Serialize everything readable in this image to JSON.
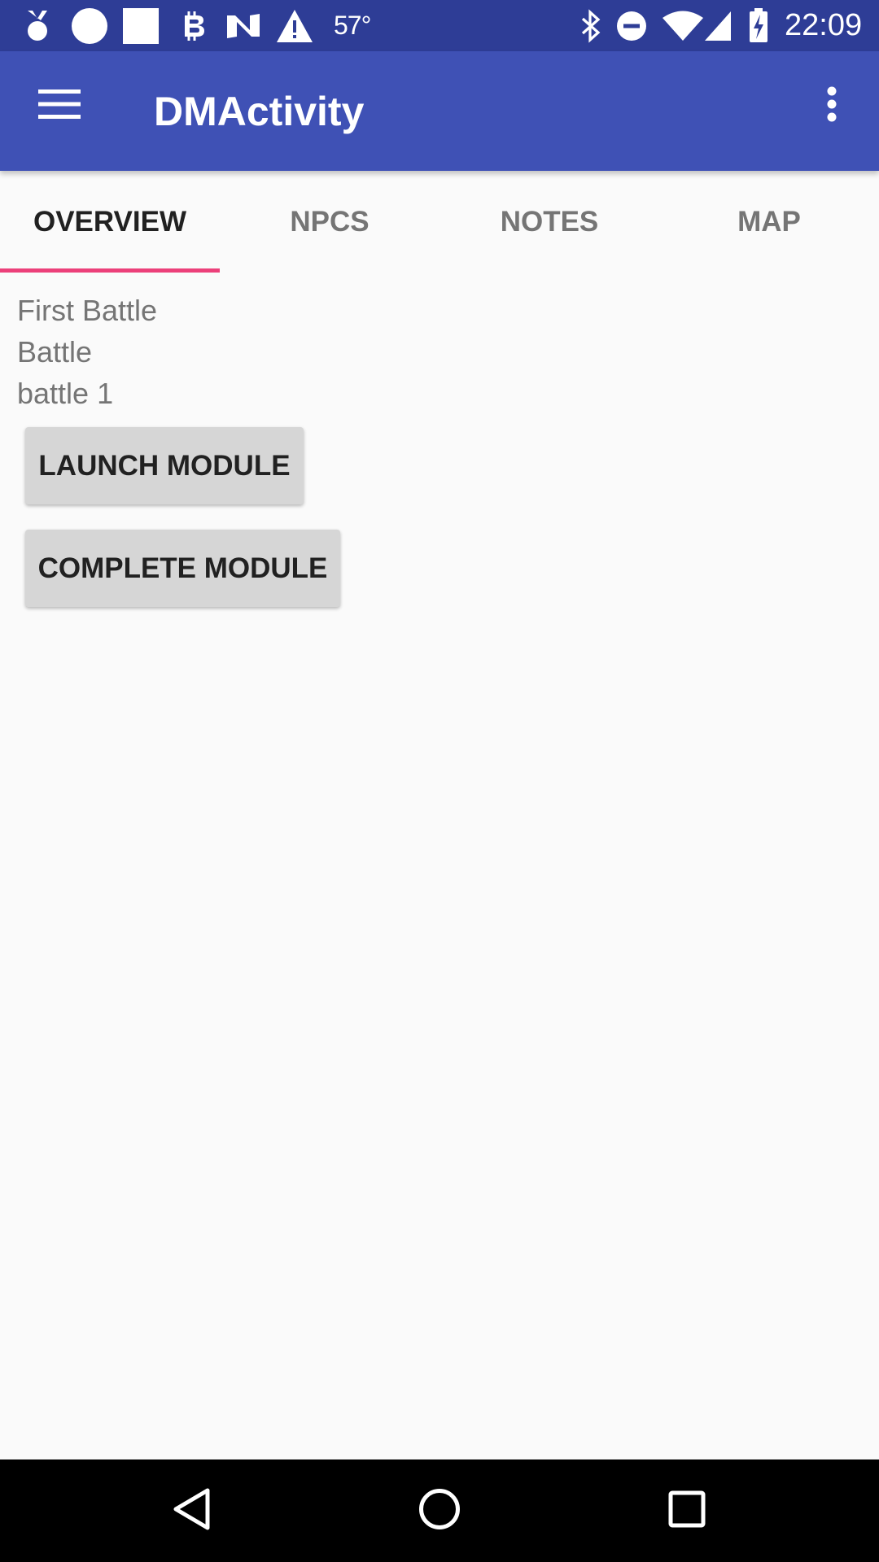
{
  "status_bar": {
    "left_icons": [
      "medal-icon",
      "circle-icon",
      "square-icon",
      "bitcoin-icon",
      "n-logo-icon",
      "warning-icon"
    ],
    "temperature": "57°",
    "right_icons": [
      "bluetooth-icon",
      "do-not-disturb-icon",
      "wifi-icon",
      "cell-signal-icon",
      "battery-charging-icon"
    ],
    "time": "22:09"
  },
  "app_bar": {
    "title": "DMActivity",
    "menu_icon": "hamburger-menu-icon",
    "overflow_icon": "more-vert-icon",
    "color": "#3f51b5"
  },
  "tabs": [
    {
      "label": "OVERVIEW",
      "active": true
    },
    {
      "label": "NPCS",
      "active": false
    },
    {
      "label": "NOTES",
      "active": false
    },
    {
      "label": "MAP",
      "active": false
    }
  ],
  "tab_indicator_color": "#ec407a",
  "overview": {
    "lines": [
      "First Battle",
      "Battle",
      "battle 1"
    ],
    "buttons": {
      "launch": "LAUNCH MODULE",
      "complete": "COMPLETE MODULE"
    }
  },
  "nav_bar": {
    "icons": [
      "back-icon",
      "home-icon",
      "recents-icon"
    ]
  }
}
